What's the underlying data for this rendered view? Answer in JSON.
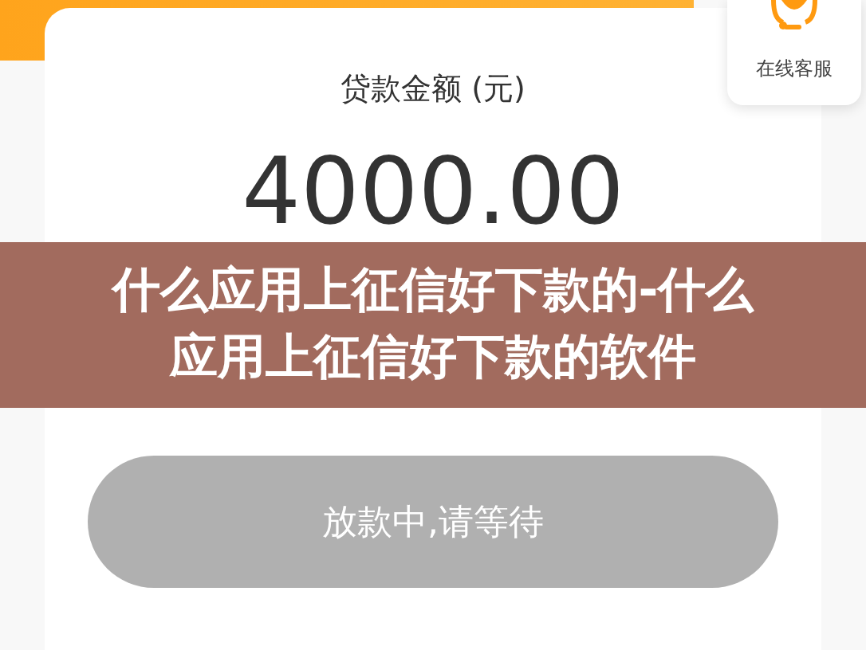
{
  "loan_card": {
    "label": "贷款金额 (元)",
    "amount": "4000.00"
  },
  "customer_service": {
    "label": "在线客服"
  },
  "submit_button": {
    "label": "放款中,请等待",
    "disabled": true
  },
  "title_banner": {
    "text": "什么应用上征信好下款的-什么应用上征信好下款的软件"
  }
}
